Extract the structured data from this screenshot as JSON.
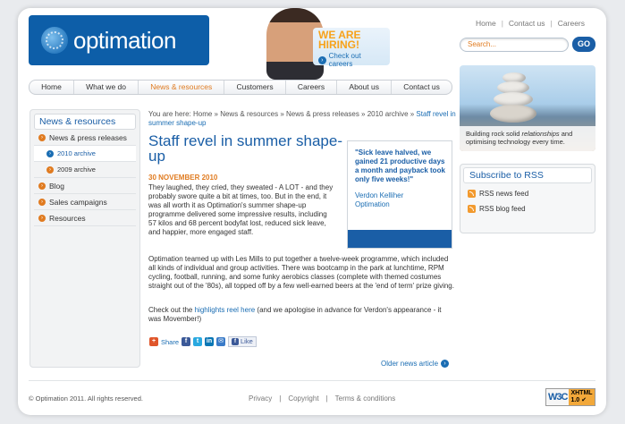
{
  "brand": {
    "logo_text": "optimation",
    "accent": "#1a5ea6",
    "orange": "#e07b20"
  },
  "hiring": {
    "title_line1": "WE ARE",
    "title_line2": "HIRING!",
    "link": "Check out careers"
  },
  "top_links": [
    "Home",
    "Contact us",
    "Careers"
  ],
  "search": {
    "placeholder": "Search...",
    "button": "GO"
  },
  "nav": [
    "Home",
    "What we do",
    "News & resources",
    "Customers",
    "Careers",
    "About us",
    "Contact us"
  ],
  "hero": {
    "caption_part1": "Building rock solid ",
    "caption_em": "relationships",
    "caption_part2": " and optimising technology every time."
  },
  "sidebar": {
    "title": "News & resources",
    "items": [
      "News & press releases",
      "2010 archive",
      "2009 archive",
      "Blog",
      "Sales campaigns",
      "Resources"
    ]
  },
  "breadcrumb": {
    "prefix": "You are here: Home » News & resources » News & press releases » 2010 archive » ",
    "current": "Staff revel in summer shape-up"
  },
  "article": {
    "title": "Staff revel in summer shape-up",
    "date": "30 NOVEMBER 2010",
    "p1": "They laughed, they cried, they sweated - A LOT - and they probably swore quite a bit at times, too. But in the end, it was all worth it as Optimation's summer shape-up programme delivered some impressive results, including 57 kilos and 68 percent bodyfat lost, reduced sick leave, and happier, more engaged staff.",
    "p2": "Optimation teamed up with Les Mills to put together a twelve-week programme, which included all kinds of individual and group activities. There was bootcamp in the park at lunchtime, RPM cycling, football, running, and some funky aerobics classes (complete with themed costumes straight out of the '80s), all topped off by a few well-earned beers at the 'end of term' prize giving.",
    "p3_before": "Check out the ",
    "p3_link": "highlights reel here",
    "p3_after": " (and we apologise in advance for Verdon's appearance - it was Movember!)"
  },
  "quote": {
    "text": "\"Sick leave halved, we gained 21 productive days a month and payback took only five weeks!\"",
    "author": "Verdon Kelliher",
    "company": "Optimation"
  },
  "share": {
    "label": "Share",
    "like": "Like"
  },
  "older": "Older news article",
  "rss": {
    "title": "Subscribe to RSS",
    "items": [
      "RSS news feed",
      "RSS blog feed"
    ]
  },
  "footer": {
    "copyright": "© Optimation 2011. All rights reserved.",
    "links": [
      "Privacy",
      "Copyright",
      "Terms & conditions"
    ],
    "badge": {
      "w3c": "W3C",
      "xhtml": "XHTML",
      "version": "1.0"
    }
  }
}
